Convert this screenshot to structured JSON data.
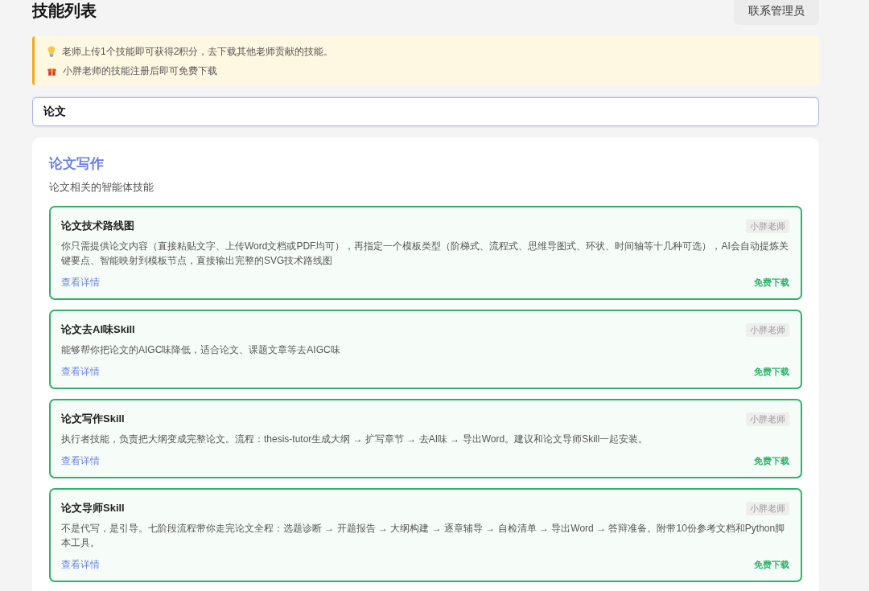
{
  "header": {
    "title": "技能列表",
    "contact_button": "联系管理员"
  },
  "notice": {
    "items": [
      {
        "kind": "bulb",
        "text": "老师上传1个技能即可获得2积分，去下载其他老师贡献的技能。"
      },
      {
        "kind": "gift",
        "text": "小胖老师的技能注册后即可免费下载"
      }
    ]
  },
  "search": {
    "value": "论文"
  },
  "section": {
    "title": "论文写作",
    "subtitle": "论文相关的智能体技能",
    "skills": [
      {
        "title": "论文技术路线图",
        "author": "小胖老师",
        "description": "你只需提供论文内容（直接粘贴文字、上传Word文档或PDF均可），再指定一个模板类型（阶梯式、流程式、思维导图式、环状、时间轴等十几种可选），AI会自动提炼关键要点、智能映射到模板节点，直接输出完整的SVG技术路线图",
        "details_link": "查看详情",
        "download": "免费下载"
      },
      {
        "title": "论文去AI味Skill",
        "author": "小胖老师",
        "description": "能够帮你把论文的AIGC味降低，适合论文、课题文章等去AIGC味",
        "details_link": "查看详情",
        "download": "免费下载"
      },
      {
        "title": "论文写作Skill",
        "author": "小胖老师",
        "description": "执行者技能，负责把大纲变成完整论文。流程：thesis-tutor生成大纲 → 扩写章节 → 去AI味 → 导出Word。建议和论文导师Skill一起安装。",
        "details_link": "查看详情",
        "download": "免费下载"
      },
      {
        "title": "论文导师Skill",
        "author": "小胖老师",
        "description": "不是代写，是引导。七阶段流程带你走完论文全程：选题诊断 → 开题报告 → 大纲构建 → 逐章辅导 → 自检清单 → 导出Word → 答辩准备。附带10份参考文档和Python脚本工具。",
        "details_link": "查看详情",
        "download": "免费下载"
      }
    ]
  }
}
